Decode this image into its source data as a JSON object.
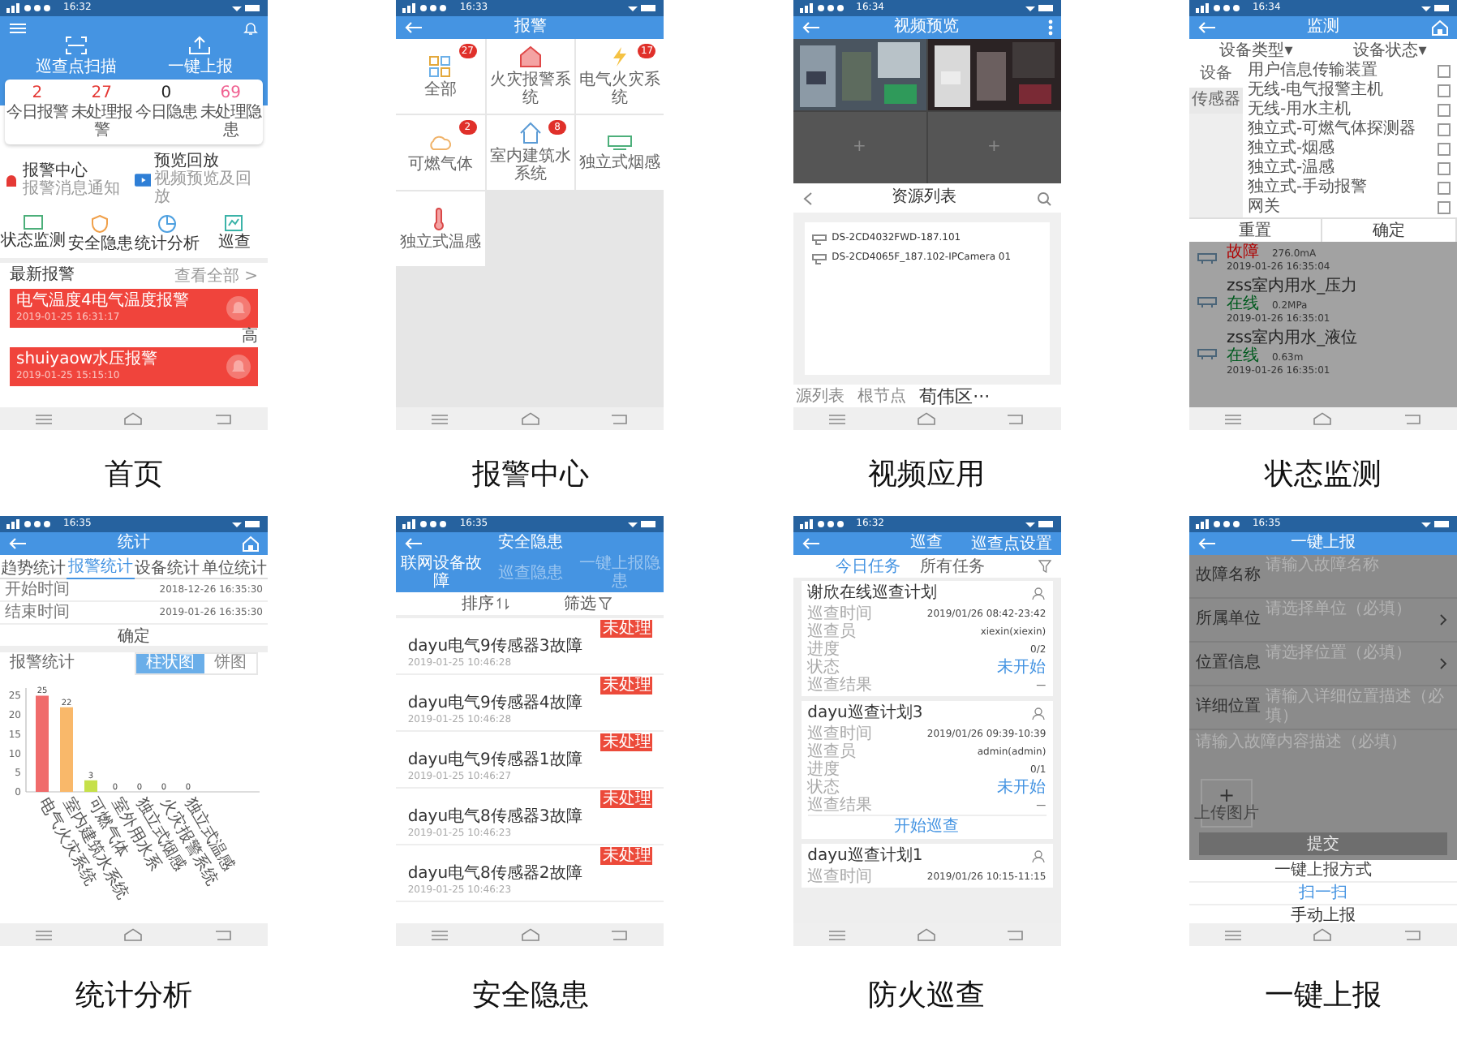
{
  "screens": [
    {
      "kind": "home",
      "caption": "首页",
      "time": "16:32",
      "actions": [
        "巡查点扫描",
        "一键上报"
      ],
      "stats": [
        {
          "value": "2",
          "label": "今日报警",
          "color": "#e53935"
        },
        {
          "value": "27",
          "label": "未处理报警",
          "color": "#e53935"
        },
        {
          "value": "0",
          "label": "今日隐患",
          "color": "#222222"
        },
        {
          "value": "69",
          "label": "未处理隐患",
          "color": "#f06292"
        }
      ],
      "shortcuts": [
        {
          "title": "报警中心",
          "subtitle": "报警消息通知"
        },
        {
          "title": "预览回放",
          "subtitle": "视频预览及回放"
        }
      ],
      "modules": [
        "状态监测",
        "安全隐患",
        "统计分析",
        "巡查"
      ],
      "latest_title": "最新报警",
      "view_all": "查看全部 >",
      "alarms": [
        {
          "title": "电气温度4电气温度报警",
          "time": "2019-01-25 16:31:17",
          "tag": "高"
        },
        {
          "title": "shuiyaow水压报警",
          "time": "2019-01-25 15:15:10"
        }
      ]
    },
    {
      "kind": "alarms",
      "caption": "报警中心",
      "time": "16:33",
      "title": "报警",
      "tiles": [
        {
          "label": "全部",
          "badge": "27"
        },
        {
          "label": "火灾报警系统"
        },
        {
          "label": "电气火灾系统",
          "badge": "17"
        },
        {
          "label": "可燃气体",
          "badge": "2"
        },
        {
          "label": "室内建筑水系统",
          "badge": "8"
        },
        {
          "label": "独立式烟感"
        },
        {
          "label": "独立式温感"
        }
      ]
    },
    {
      "kind": "video",
      "caption": "视频应用",
      "time": "16:34",
      "title": "视频预览",
      "cells": [
        {
          "kind": "picture"
        },
        {
          "kind": "picture"
        },
        {
          "kind": "empty",
          "label": "+"
        },
        {
          "kind": "empty",
          "label": "+"
        }
      ],
      "resource_title": "资源列表",
      "devices": [
        "DS-2CD4032FWD-187.101",
        "DS-2CD4065F_187.102-IPCamera 01"
      ],
      "breadcrumb": [
        {
          "label": "源列表",
          "selected": false
        },
        {
          "label": "根节点",
          "selected": false
        },
        {
          "label": "荀伟区···",
          "selected": true
        }
      ]
    },
    {
      "kind": "monitor",
      "caption": "状态监测",
      "time": "16:34",
      "title": "监测",
      "filters": [
        "设备类型▾",
        "设备状态▾"
      ],
      "categories": [
        {
          "label": "设备",
          "selected": true
        },
        {
          "label": "传感器",
          "selected": false
        }
      ],
      "options": [
        {
          "label": "用户信息传输装置",
          "checked": false
        },
        {
          "label": "无线-电气报警主机",
          "checked": false
        },
        {
          "label": "无线-用水主机",
          "checked": false
        },
        {
          "label": "独立式-可燃气体探测器",
          "checked": false
        },
        {
          "label": "独立式-烟感",
          "checked": false
        },
        {
          "label": "独立式-温感",
          "checked": false
        },
        {
          "label": "独立式-手动报警",
          "checked": false
        },
        {
          "label": "网关",
          "checked": false
        }
      ],
      "buttons": [
        "重置",
        "确定"
      ],
      "readings": [
        {
          "status": "故障",
          "color": "#b00000",
          "value": "276.0mA",
          "time": "2019-01-26 16:35:04"
        },
        {
          "name": "zss室内用水_压力",
          "status": "在线",
          "color": "#005a1e",
          "value": "0.2MPa",
          "time": "2019-01-26 16:35:01"
        },
        {
          "name": "zss室内用水_液位",
          "status": "在线",
          "color": "#005a1e",
          "value": "0.63m",
          "time": "2019-01-26 16:35:01"
        }
      ]
    },
    {
      "kind": "stats",
      "caption": "统计分析",
      "time": "16:35",
      "title": "统计",
      "tabs": [
        {
          "label": "趋势统计",
          "selected": false
        },
        {
          "label": "报警统计",
          "selected": true
        },
        {
          "label": "设备统计",
          "selected": false
        },
        {
          "label": "单位统计",
          "selected": false
        }
      ],
      "dates": [
        {
          "label": "开始时间",
          "value": "2018-12-26 16:35:30"
        },
        {
          "label": "结束时间",
          "value": "2019-01-26 16:35:30"
        }
      ],
      "confirm": "确定",
      "chart_title": "报警统计",
      "toggle": [
        {
          "label": "柱状图",
          "selected": true
        },
        {
          "label": "饼图",
          "selected": false
        }
      ],
      "chart_data": {
        "type": "bar",
        "categories": [
          "电气火灾系统",
          "室内建筑水系统",
          "可燃气体",
          "室外用水系",
          "独立式烟感",
          "火灾报警系统",
          "独立式温感"
        ],
        "values": [
          25,
          22,
          3,
          0,
          0,
          0,
          0
        ],
        "colors": [
          "#f06b6b",
          "#f9b86a",
          "#c6e04a",
          "#999999",
          "#999999",
          "#999999",
          "#999999"
        ],
        "yticks": [
          0,
          5,
          10,
          15,
          20,
          25
        ],
        "ylim": [
          0,
          27
        ],
        "data_labels": true
      }
    },
    {
      "kind": "hazards",
      "caption": "安全隐患",
      "time": "16:35",
      "title": "安全隐患",
      "tabs": [
        {
          "label": "联网设备故障",
          "selected": true
        },
        {
          "label": "巡查隐患",
          "selected": false
        },
        {
          "label": "一键上报隐患",
          "selected": false
        }
      ],
      "sort": "排序",
      "filter": "筛选",
      "items": [
        {
          "title": "dayu电气9传感器3故障",
          "time": "2019-01-25 10:46:28",
          "badge": "未处理"
        },
        {
          "title": "dayu电气9传感器4故障",
          "time": "2019-01-25 10:46:28",
          "badge": "未处理"
        },
        {
          "title": "dayu电气9传感器1故障",
          "time": "2019-01-25 10:46:27",
          "badge": "未处理"
        },
        {
          "title": "dayu电气8传感器3故障",
          "time": "2019-01-25 10:46:23",
          "badge": "未处理"
        },
        {
          "title": "dayu电气8传感器2故障",
          "time": "2019-01-25 10:46:23",
          "badge": "未处理"
        }
      ]
    },
    {
      "kind": "patrol",
      "caption": "防火巡查",
      "time": "16:32",
      "title": "巡查",
      "header_action": "巡查点设置",
      "tabs": [
        {
          "label": "今日任务",
          "selected": true
        },
        {
          "label": "所有任务",
          "selected": false
        }
      ],
      "tasks": [
        {
          "title": "谢欣在线巡查计划",
          "rows": [
            {
              "label": "巡查时间",
              "value": "2019/01/26 08:42-23:42",
              "highlight": false
            },
            {
              "label": "巡查员",
              "value": "xiexin(xiexin)",
              "highlight": false
            },
            {
              "label": "进度",
              "value": "0/2",
              "highlight": false
            },
            {
              "label": "状态",
              "value": "未开始",
              "highlight": true
            },
            {
              "label": "巡查结果",
              "value": "—",
              "highlight": false
            }
          ]
        },
        {
          "title": "dayu巡查计划3",
          "rows": [
            {
              "label": "巡查时间",
              "value": "2019/01/26 09:39-10:39",
              "highlight": false
            },
            {
              "label": "巡查员",
              "value": "admin(admin)",
              "highlight": false
            },
            {
              "label": "进度",
              "value": "0/1",
              "highlight": false
            },
            {
              "label": "状态",
              "value": "未开始",
              "highlight": true
            },
            {
              "label": "巡查结果",
              "value": "—",
              "highlight": false
            }
          ],
          "button": "开始巡查"
        },
        {
          "title": "dayu巡查计划1",
          "rows": [
            {
              "label": "巡查时间",
              "value": "2019/01/26 10:15-11:15",
              "highlight": false
            }
          ]
        }
      ]
    },
    {
      "kind": "report",
      "caption": "一键上报",
      "time": "16:35",
      "title": "一键上报",
      "fields": [
        {
          "label": "故障名称",
          "placeholder": "请输入故障名称",
          "chevron": false
        },
        {
          "label": "所属单位",
          "placeholder": "请选择单位（必填）",
          "chevron": true
        },
        {
          "label": "位置信息",
          "placeholder": "请选择位置（必填）",
          "chevron": true
        },
        {
          "label": "详细位置",
          "placeholder": "请输入详细位置描述（必填）",
          "chevron": false
        }
      ],
      "description_placeholder": "请输入故障内容描述（必填）",
      "upload": "上传图片",
      "upload_mark": "+",
      "submit": "提交",
      "sheet_title": "一键上报方式",
      "sheet_options": [
        {
          "label": "扫一扫",
          "selected": true
        },
        {
          "label": "手动上报",
          "selected": false
        }
      ]
    }
  ]
}
